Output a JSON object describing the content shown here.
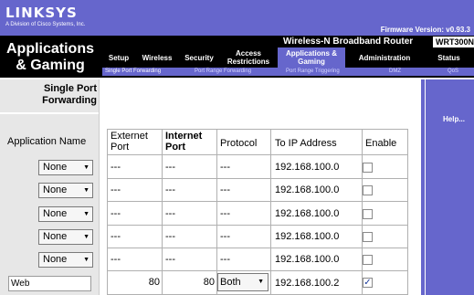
{
  "brand": {
    "logo": "LINKSYS",
    "sub": "A Division of Cisco Systems, Inc."
  },
  "firmware": "Firmware Version: v0.93.3",
  "section": {
    "line1": "Applications",
    "line2": "& Gaming"
  },
  "product": {
    "name": "Wireless-N Broadband Router",
    "model": "WRT300N"
  },
  "tabs": [
    {
      "label": "Setup"
    },
    {
      "label": "Wireless"
    },
    {
      "label": "Security"
    },
    {
      "label": "Access Restrictions"
    },
    {
      "label": "Applications & Gaming"
    },
    {
      "label": "Administration"
    },
    {
      "label": "Status"
    }
  ],
  "subtabs": [
    {
      "label": "Single Port Forwarding"
    },
    {
      "label": "Port Range Forwarding"
    },
    {
      "label": "Port Range Triggering"
    },
    {
      "label": "DMZ"
    },
    {
      "label": "QoS"
    }
  ],
  "left": {
    "title_line1": "Single Port",
    "title_line2": "Forwarding",
    "app_label": "Application Name"
  },
  "help": {
    "label": "Help..."
  },
  "table": {
    "headers": {
      "external_port": "Externet Port",
      "internet_port": "Internet Port",
      "protocol": "Protocol",
      "to_ip": "To IP Address",
      "enable": "Enable"
    },
    "rows": [
      {
        "app": "None",
        "ext": "---",
        "int": "---",
        "proto": "---",
        "ip": "192.168.100.0",
        "enabled": false
      },
      {
        "app": "None",
        "ext": "---",
        "int": "---",
        "proto": "---",
        "ip": "192.168.100.0",
        "enabled": false
      },
      {
        "app": "None",
        "ext": "---",
        "int": "---",
        "proto": "---",
        "ip": "192.168.100.0",
        "enabled": false
      },
      {
        "app": "None",
        "ext": "---",
        "int": "---",
        "proto": "---",
        "ip": "192.168.100.0",
        "enabled": false
      },
      {
        "app": "None",
        "ext": "---",
        "int": "---",
        "proto": "---",
        "ip": "192.168.100.0",
        "enabled": false
      },
      {
        "app": "Web",
        "ext": "80",
        "int": "80",
        "proto": "Both",
        "ip": "192.168.100.2",
        "enabled": true
      }
    ]
  },
  "colors": {
    "header_purple": "#6666cc",
    "header_black": "#000000",
    "left_gray": "#e7e7e7"
  }
}
